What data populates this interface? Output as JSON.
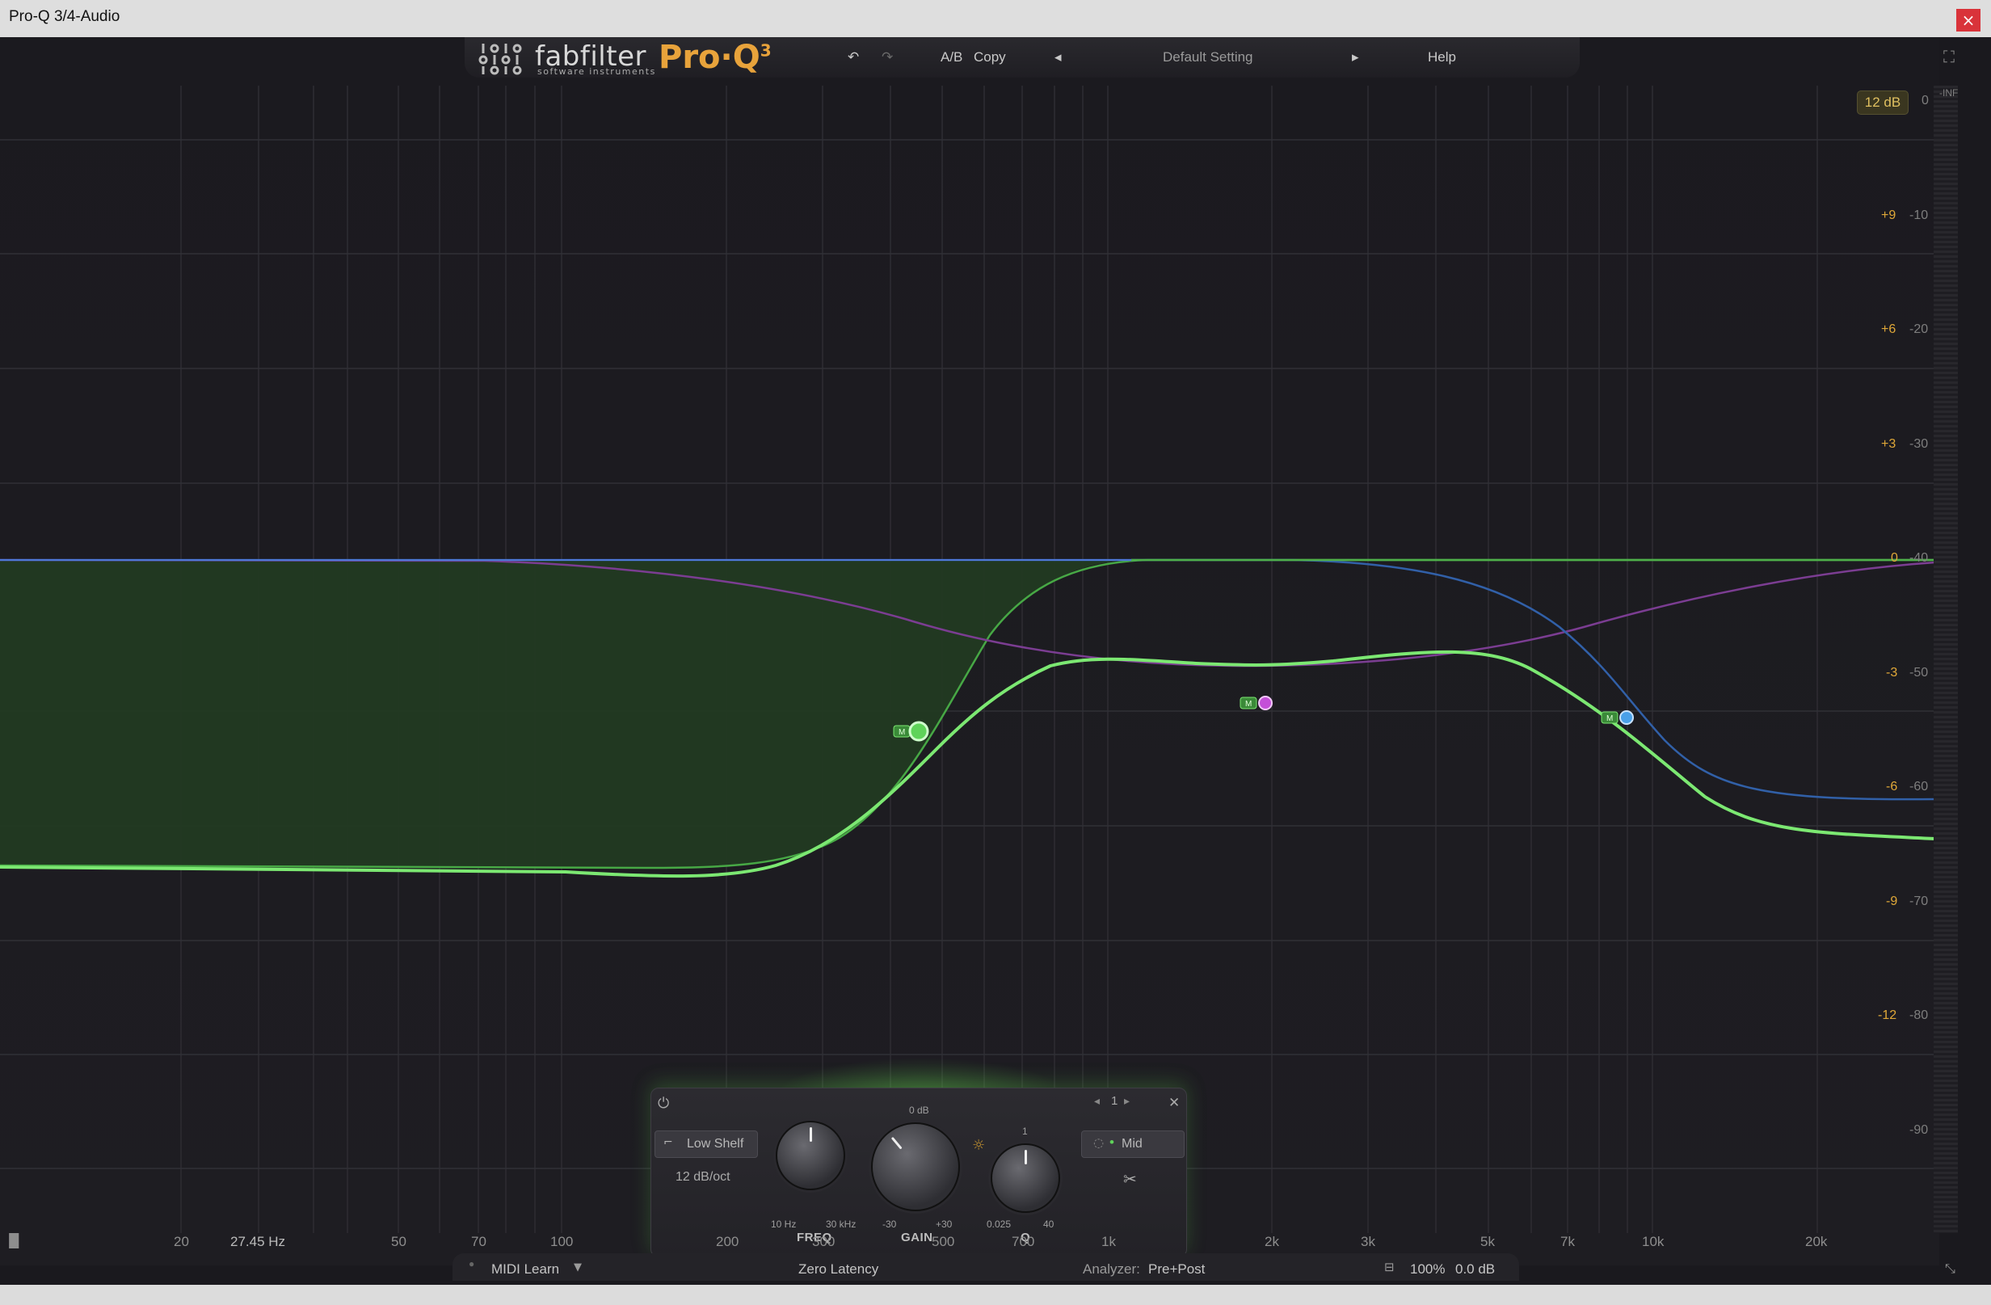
{
  "window": {
    "title": "Pro-Q 3/4-Audio",
    "close_label": "×"
  },
  "header": {
    "brand": "fabfilter",
    "brand_sub": "software instruments",
    "product": "Pro·Q",
    "product_version": "3",
    "undo_icon": "↶",
    "redo_icon": "↷",
    "ab_label": "A/B",
    "copy_label": "Copy",
    "prev_icon": "◂",
    "preset_name": "Default Setting",
    "next_icon": "▸",
    "help_label": "Help",
    "fullscreen_icon": "⛶"
  },
  "display": {
    "range_tag": "12 dB",
    "inf_label": "-INF",
    "gain_scale": [
      "+9",
      "+6",
      "+3",
      "0",
      "-3",
      "-6",
      "-9",
      "-12"
    ],
    "db_scale": [
      "0",
      "-10",
      "-20",
      "-30",
      "-40",
      "-50",
      "-60",
      "-70",
      "-80",
      "-90"
    ]
  },
  "freq_axis": [
    "20",
    "27.45 Hz",
    "50",
    "70",
    "100",
    "200",
    "300",
    "500",
    "700",
    "1k",
    "2k",
    "3k",
    "5k",
    "7k",
    "10k",
    "20k"
  ],
  "bands": [
    {
      "name": "band-1-low-shelf",
      "color": "#5fd35a",
      "freq_label": "27.45 Hz"
    },
    {
      "name": "band-2-bell",
      "color": "#c44fd8"
    },
    {
      "name": "band-3-high-shelf",
      "color": "#4aa0e8"
    }
  ],
  "band_panel": {
    "power_icon": "⏻",
    "band_number": "1",
    "close_icon": "✕",
    "shape_label": "Low Shelf",
    "slope_label": "12 dB/oct",
    "freq": {
      "label": "FREQ",
      "min": "10 Hz",
      "max": "30 kHz"
    },
    "gain": {
      "label": "GAIN",
      "min": "-30",
      "max": "+30",
      "top": "0 dB"
    },
    "q": {
      "label": "Q",
      "min": "0.025",
      "max": "40",
      "top": "1"
    },
    "stereo_label": "Mid",
    "scissors_icon": "✂"
  },
  "status": {
    "midi_learn": "MIDI Learn",
    "latency": "Zero Latency",
    "analyzer_label": "Analyzer:",
    "analyzer_value": "Pre+Post",
    "zoom": "100%",
    "output_gain": "0.0 dB"
  }
}
